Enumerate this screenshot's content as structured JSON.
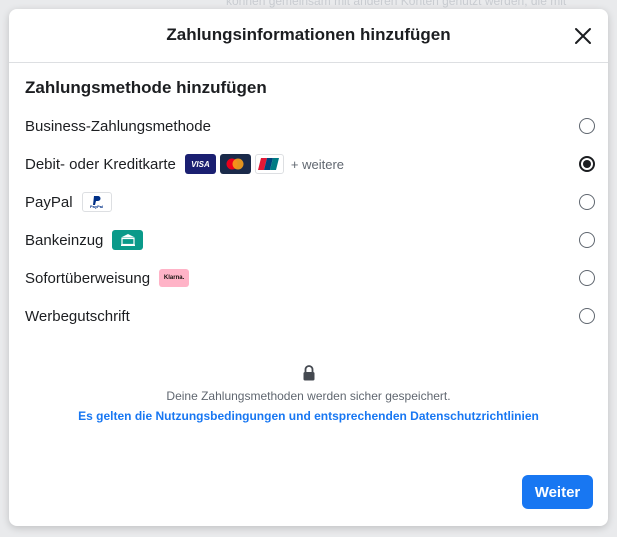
{
  "background": {
    "text": "können gemeinsam mit anderen Konten genutzt werden, die mit"
  },
  "dialog": {
    "title": "Zahlungsinformationen hinzufügen",
    "section_title": "Zahlungsmethode hinzufügen",
    "methods": [
      {
        "label": "Business-Zahlungsmethode",
        "selected": false
      },
      {
        "label": "Debit- oder Kreditkarte",
        "selected": true,
        "cards": [
          "VISA",
          "Mastercard",
          "UnionPay"
        ],
        "more": "+ weitere"
      },
      {
        "label": "PayPal",
        "selected": false,
        "badge": "PayPal"
      },
      {
        "label": "Bankeinzug",
        "selected": false,
        "badge": "bank-icon"
      },
      {
        "label": "Sofortüberweisung",
        "selected": false,
        "badge": "Klarna."
      },
      {
        "label": "Werbegutschrift",
        "selected": false
      }
    ],
    "secure_note": "Deine Zahlungsmethoden werden sicher gespeichert.",
    "terms_link": "Es gelten die Nutzungsbedingungen und entsprechenden Datenschutzrichtlinien",
    "next_button": "Weiter"
  },
  "colors": {
    "accent": "#1877f2",
    "text": "#1c1e21",
    "secondary": "#606770"
  }
}
